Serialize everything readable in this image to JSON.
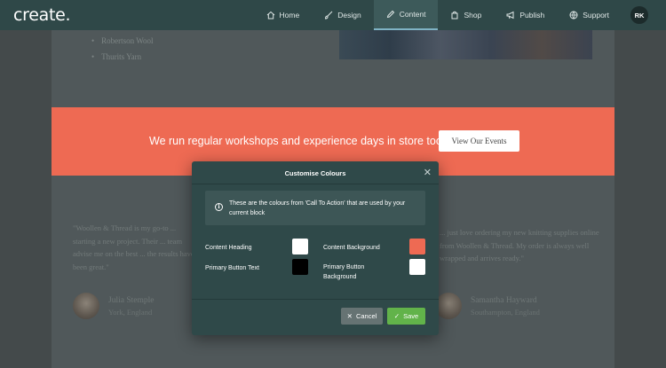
{
  "app": {
    "logo": "create."
  },
  "nav": {
    "items": [
      {
        "label": "Home",
        "icon": "home-icon"
      },
      {
        "label": "Design",
        "icon": "brush-icon"
      },
      {
        "label": "Content",
        "icon": "edit-icon",
        "active": true
      },
      {
        "label": "Shop",
        "icon": "bag-icon"
      },
      {
        "label": "Publish",
        "icon": "megaphone-icon"
      },
      {
        "label": "Support",
        "icon": "globe-icon"
      }
    ],
    "avatar": "RK"
  },
  "page": {
    "list": [
      "Robertson Wool",
      "Thurits Yarn"
    ],
    "cta": {
      "text": "We run regular workshops and experience days in store too",
      "button": "View Our Events",
      "color": "#ee6a53"
    },
    "testimonials": [
      {
        "quote": "\"Woollen & Thread is my go-to ... starting a new project. Their ... team advise me on the best ... the results have been great.\"",
        "name": "Julia Stemple",
        "location": "York, England"
      },
      {
        "quote": "... just love ordering my new knitting supplies online from Woollen & Thread. My order is always well wrapped and arrives ready.\"",
        "name": "Samantha Hayward",
        "location": "Southampton, England"
      }
    ]
  },
  "modal": {
    "title": "Customise Colours",
    "info": "These are the colours from 'Call To Action' that are used by your current block",
    "fields": [
      {
        "label": "Content Heading",
        "color": "#ffffff"
      },
      {
        "label": "Content Background",
        "color": "#ee6a53"
      },
      {
        "label": "Primary Button Text",
        "color": "#000000"
      },
      {
        "label": "Primary Button Background",
        "color": "#ffffff"
      }
    ],
    "cancel": "Cancel",
    "save": "Save"
  }
}
